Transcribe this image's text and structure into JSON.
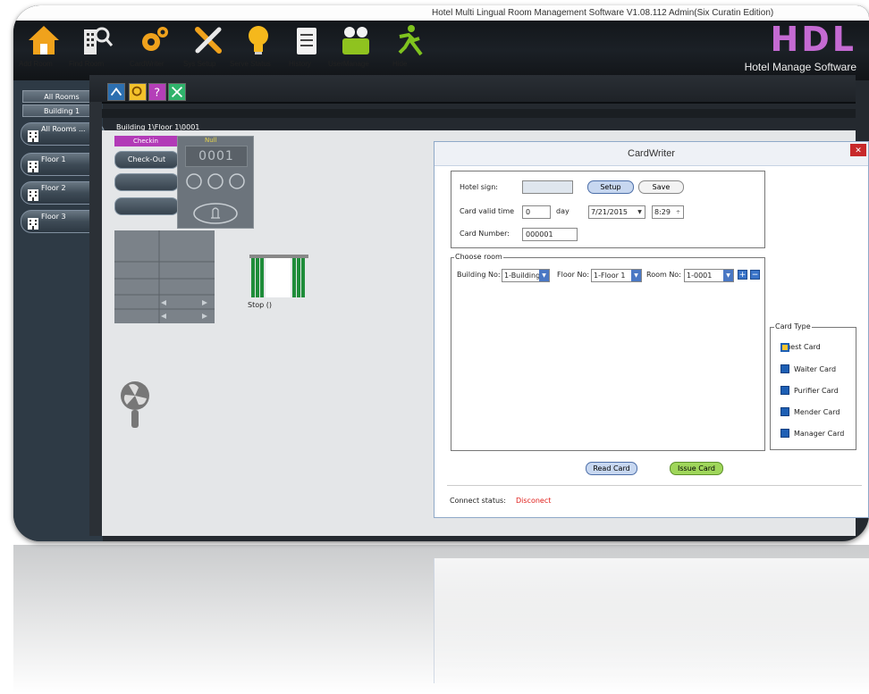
{
  "window": {
    "title": "Hotel Multi Lingual Room Management Software V1.08.112   Admin(Six Curatin Edition)"
  },
  "toolbar": {
    "items": [
      {
        "label": "Add Room",
        "icon": "house-icon"
      },
      {
        "label": "Find Room",
        "icon": "find-room-icon"
      },
      {
        "label": "CardWriter",
        "icon": "gears-icon"
      },
      {
        "label": "Sys Setup",
        "icon": "tools-icon"
      },
      {
        "label": "Serve Status",
        "icon": "lightbulb-icon"
      },
      {
        "label": "History",
        "icon": "document-icon"
      },
      {
        "label": "UserManage",
        "icon": "users-icon"
      },
      {
        "label": "Hide",
        "icon": "running-man-icon"
      }
    ]
  },
  "brand": {
    "logo": "HDL",
    "subtitle": "Hotel Manage Software",
    "color": "#c46ad2"
  },
  "sidebar": {
    "tabs": [
      "All Rooms",
      "Building 1"
    ],
    "items": [
      {
        "label": "All Rooms ..."
      },
      {
        "label": "Floor 1"
      },
      {
        "label": "Floor 2"
      },
      {
        "label": "Floor 3"
      }
    ]
  },
  "breadcrumb": "Building 1\\Floor 1\\0001",
  "room_panel": {
    "checkin": "Checkin",
    "checkout": "Check-Out",
    "ac_status": "Null",
    "ac_display": "0001",
    "curtain_label": "Stop ()"
  },
  "dialog": {
    "title": "CardWriter",
    "hotel_sign_label": "Hotel sign:",
    "setup_button": "Setup",
    "save_button": "Save",
    "card_valid_label": "Card valid time",
    "card_valid_days": "0",
    "day_label": "day",
    "date_value": "7/21/2015",
    "time_value": "8:29",
    "card_number_label": "Card Number:",
    "card_number": "000001",
    "choose_room_legend": "Choose room",
    "building_label": "Building No:",
    "building_value": "1-Building",
    "floor_label": "Floor No:",
    "floor_value": "1-Floor 1",
    "room_label": "Room No:",
    "room_value": "1-0001",
    "card_type_legend": "Card Type",
    "card_types": [
      {
        "label": "Guest Card",
        "selected": true
      },
      {
        "label": "Waiter Card",
        "selected": false
      },
      {
        "label": "Purifier Card",
        "selected": false
      },
      {
        "label": "Mender Card",
        "selected": false
      },
      {
        "label": "Manager Card",
        "selected": false
      }
    ],
    "read_button": "Read Card",
    "issue_button": "Issue Card",
    "connect_label": "Connect status:",
    "connect_value": "Disconect",
    "connect_color": "#e0201c"
  }
}
